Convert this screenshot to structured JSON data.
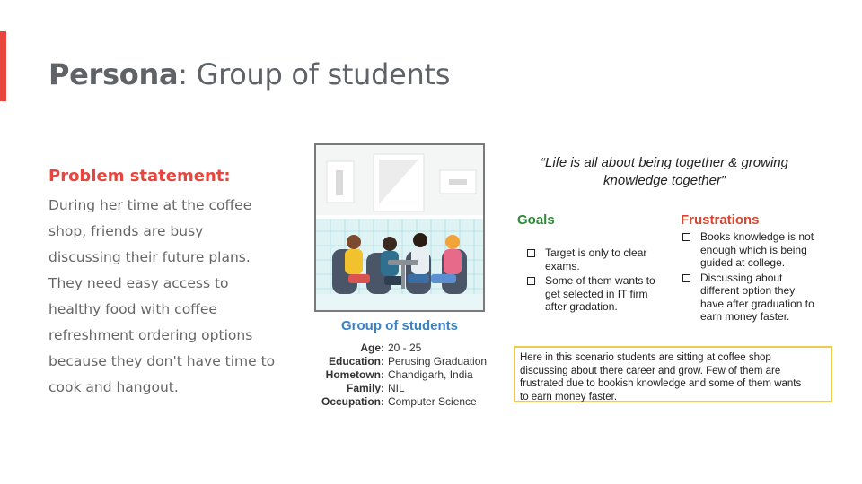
{
  "slide": {
    "title_bold": "Persona",
    "title_rest": ": Group of students",
    "accent_color": "#e8453c"
  },
  "problem": {
    "heading": "Problem statement:",
    "lines": [
      "During her time at the coffee",
      "shop, friends are busy",
      "discussing their future plans.",
      "They need easy access to",
      "healthy food with coffee",
      "refreshment ordering options",
      "because they don't have time to",
      "cook and hangout."
    ]
  },
  "persona": {
    "image": "group-of-students-at-cafe-table-illustration",
    "name": "Group of students",
    "details": [
      {
        "label": "Age:",
        "value": "20 - 25"
      },
      {
        "label": "Education:",
        "value": "Perusing Graduation"
      },
      {
        "label": "Hometown:",
        "value": "Chandigarh, India"
      },
      {
        "label": "Family:",
        "value": "NIL"
      },
      {
        "label": "Occupation:",
        "value": "Computer Science"
      }
    ]
  },
  "quote": {
    "lines": [
      "“Life is all about being together & growing",
      "knowledge together”"
    ]
  },
  "goals": {
    "heading": "Goals",
    "color": "#2e8b3a",
    "items": [
      [
        "Target is only to clear",
        "exams."
      ],
      [
        "Some of them wants to",
        "get selected in IT firm",
        "after gradation."
      ]
    ]
  },
  "frustrations": {
    "heading": "Frustrations",
    "color": "#d64531",
    "items": [
      [
        "Books knowledge is not",
        "enough which is being",
        "guided at college."
      ],
      [
        "Discussing about",
        "different option they",
        "have after graduation to",
        "earn money faster."
      ]
    ]
  },
  "scenario": {
    "lines": [
      "Here in this scenario students are sitting at coffee shop",
      "discussing about there career and grow. Few of them are",
      "frustrated due to bookish knowledge and some of them wants",
      "to earn money faster."
    ]
  }
}
